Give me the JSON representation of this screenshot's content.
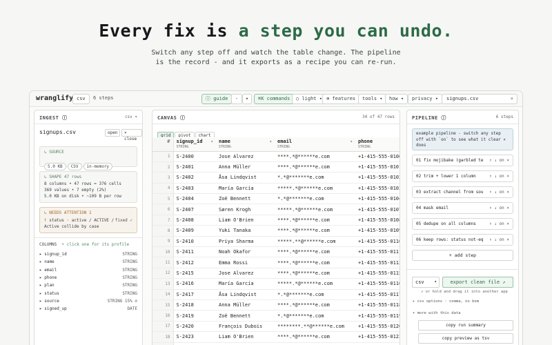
{
  "hero": {
    "title_plain": "Every fix is ",
    "title_accent": "a step you can undo.",
    "sub_line1": "Switch any step off and watch the table change. The pipeline",
    "sub_line2": "is the record - and it exports as a recipe you can re-run."
  },
  "topbar": {
    "brand": "wranglify",
    "file_type": "csv",
    "steps": "6 steps",
    "guide": "ⓘ guide",
    "minus": "-",
    "dropdown": "▾",
    "commands": "⌘K commands",
    "light": "○ light ▾",
    "features": "⊕ features",
    "tools": "tools ▾",
    "how": "how ▾",
    "privacy": "privacy ▾",
    "search_value": "signups.csv",
    "close": "×"
  },
  "ingest": {
    "title": "INGEST ⓘ",
    "kind": "csv ▾",
    "filename": "signups.csv",
    "open": "open",
    "close": "× close",
    "source_h": "↳ SOURCE",
    "chips": [
      "5.0 KB",
      "CSV",
      "in-memory"
    ],
    "shape_h": "↳ SHAPE 47 rows",
    "shape_lines": [
      "8 columns • 47 rows = 376 cells",
      "369 values • 7 empty (2%)",
      "5.0 KB on disk • ~109 B per row"
    ],
    "needs_h": "↳ NEEDS ATTENTION 1",
    "needs_lines": [
      "! status · active / ACTIVE /",
      "Active collide by case"
    ],
    "needs_state": "fixed ✓",
    "columns_h": "COLUMNS",
    "columns_hint": "• click one for its profile",
    "columns": [
      {
        "name": "signup_id",
        "type": "STRING"
      },
      {
        "name": "name",
        "type": "STRING"
      },
      {
        "name": "email",
        "type": "STRING"
      },
      {
        "name": "phone",
        "type": "STRING"
      },
      {
        "name": "plan",
        "type": "STRING"
      },
      {
        "name": "status",
        "type": "STRING"
      },
      {
        "name": "source",
        "type": "STRING 15% ⊘"
      },
      {
        "name": "signed_up",
        "type": "DATE"
      }
    ]
  },
  "canvas": {
    "title": "CANVAS ⓘ",
    "count": "34 of 47 rows",
    "tabs": [
      "grid",
      "pivot",
      "chart"
    ],
    "headers": [
      {
        "name": "#",
        "type": ""
      },
      {
        "name": "signup_id",
        "type": "STRING"
      },
      {
        "name": "name",
        "type": "STRING"
      },
      {
        "name": "email",
        "type": "STRING"
      },
      {
        "name": "phone",
        "type": "STRING"
      }
    ],
    "rows": [
      [
        "1",
        "S-2400",
        "Jose Alvarez",
        "****.*@******e.com",
        "+1-415-555-0100"
      ],
      [
        "2",
        "S-2401",
        "Anna Müller",
        "****.*@******e.com",
        "+1-415-555-0101"
      ],
      [
        "3",
        "S-2402",
        "Åsa Lindqvist",
        "*.*@*******e.com",
        "+1-415-555-0102"
      ],
      [
        "4",
        "S-2403",
        "María García",
        "*****.*@******e.com",
        "+1-415-555-0103"
      ],
      [
        "5",
        "S-2404",
        "Zoë Bennett",
        "*.*@*******e.com",
        "+1-415-555-0104"
      ],
      [
        "6",
        "S-2407",
        "Søren Krogh",
        "*****.*@******e.com",
        "+1-415-555-0107"
      ],
      [
        "7",
        "S-2408",
        "Liam O'Brien",
        "****.*@******e.com",
        "+1-415-555-0108"
      ],
      [
        "8",
        "S-2409",
        "Yuki Tanaka",
        "****.*@******e.com",
        "+1-415-555-0109"
      ],
      [
        "9",
        "S-2410",
        "Priya Sharma",
        "*****.**@******e.com",
        "+1-415-555-0110"
      ],
      [
        "10",
        "S-2411",
        "Noah Okafor",
        "****.*@******e.com",
        "+1-415-555-0111"
      ],
      [
        "11",
        "S-2412",
        "Emma Rossi",
        "****.*@******e.com",
        "+1-415-555-0112"
      ],
      [
        "12",
        "S-2415",
        "Jose Alvarez",
        "****.*@******e.com",
        "+1-415-555-0115"
      ],
      [
        "13",
        "S-2416",
        "María García",
        "*****.*@******e.com",
        "+1-415-555-0116"
      ],
      [
        "14",
        "S-2417",
        "Åsa Lindqvist",
        "*.*@*******e.com",
        "+1-415-555-0117"
      ],
      [
        "15",
        "S-2418",
        "Anna Müller",
        "****.*@******e.com",
        "+1-415-555-0118"
      ],
      [
        "16",
        "S-2419",
        "Zoë Bennett",
        "*.*@*******e.com",
        "+1-415-555-0119"
      ],
      [
        "17",
        "S-2420",
        "François Dubois",
        "********.**@******e.com",
        "+1-415-555-0120"
      ],
      [
        "18",
        "S-2423",
        "Liam O'Brien",
        "****.*@******e.com",
        "+1-415-555-0123"
      ],
      [
        "19",
        "S-2424",
        "Yuki Tanaka",
        "****.*@******e.com",
        "+1-415-555-0124"
      ]
    ]
  },
  "pipeline": {
    "title": "PIPELINE ⓘ",
    "count": "6 steps",
    "note": "example pipeline - switch any step off with `on` to see what it  clear × does",
    "steps": [
      {
        "label": "01 fix mojibake (garbled te",
        "ctrl": "↑ ↓ on ×"
      },
      {
        "label": "02 trim + lower 1 column",
        "ctrl": "↑ ↓ on ×"
      },
      {
        "label": "03 extract channel from sou",
        "ctrl": "↑ ↓ on ×"
      },
      {
        "label": "04 mask email",
        "ctrl": "↑ ↓ on ×"
      },
      {
        "label": "05 dedupe on all columns",
        "ctrl": "↑ ↓ on ×"
      },
      {
        "label": "06 keep rows: status not-eq",
        "ctrl": "↑ ↓ on ×"
      }
    ],
    "add_step": "+ add step",
    "format": "csv",
    "export": "export clean file ↗",
    "hint": "↗ or hold and drag it into another app",
    "csv_options": "▸ csv options · comma, no bom",
    "more": "▾ more with this data",
    "copy_summary": "copy run summary",
    "copy_preview": "copy preview as tsv"
  }
}
